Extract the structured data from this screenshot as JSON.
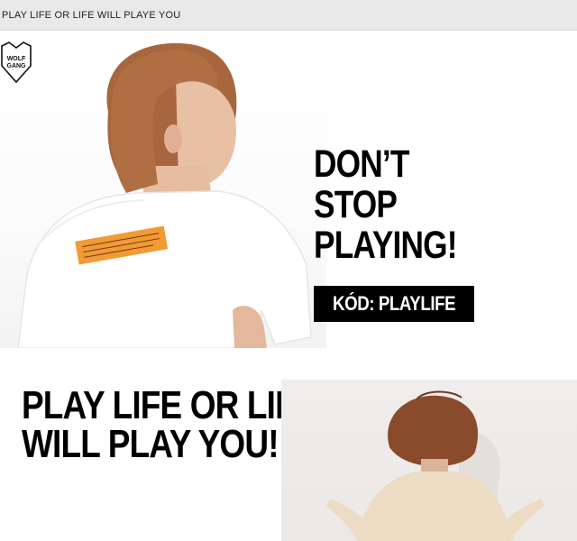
{
  "topbar": {
    "text": "PLAY LIFE OR LIFE WILL PLAYE YOU"
  },
  "hero1": {
    "logo_text": [
      "WOLF",
      "GANG"
    ],
    "heading": [
      "DON’T",
      "STOP",
      "PLAYING!"
    ],
    "code_button": "KÓD: PLAYLIFE"
  },
  "hero2": {
    "heading": [
      "PLAY LIFE OR LIFE",
      "WILL PLAY YOU!"
    ]
  },
  "colors": {
    "accent": "#f39a35",
    "dark": "#000000",
    "topbar": "#e9e9e9"
  }
}
